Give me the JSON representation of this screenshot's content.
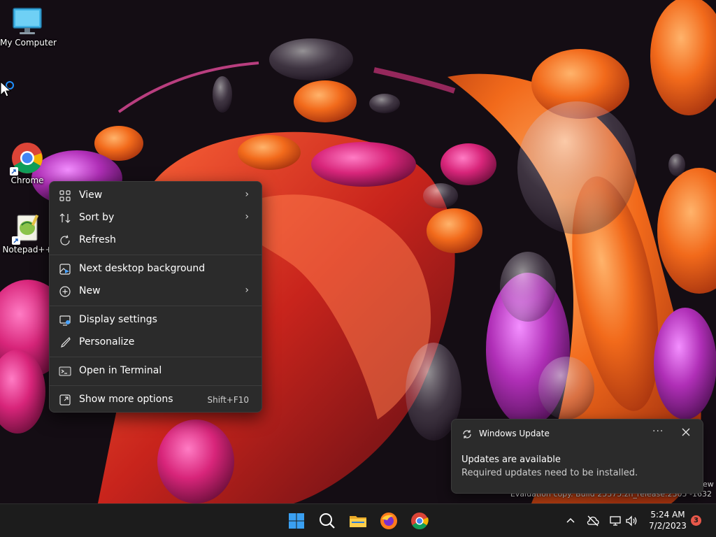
{
  "desktop": {
    "icons": [
      {
        "label": "My Computer",
        "icon": "monitor-icon"
      },
      {
        "label": "Chrome",
        "icon": "chrome-icon"
      },
      {
        "label": "Notepad++",
        "icon": "notepadpp-icon"
      }
    ]
  },
  "context_menu": {
    "items": [
      {
        "label": "View",
        "icon": "grid-icon",
        "has_submenu": true
      },
      {
        "label": "Sort by",
        "icon": "sort-icon",
        "has_submenu": true
      },
      {
        "label": "Refresh",
        "icon": "refresh-icon"
      },
      {
        "label": "Next desktop background",
        "icon": "next-background-icon"
      },
      {
        "label": "New",
        "icon": "plus-circle-icon",
        "has_submenu": true
      },
      {
        "label": "Display settings",
        "icon": "display-icon"
      },
      {
        "label": "Personalize",
        "icon": "brush-icon"
      },
      {
        "label": "Open in Terminal",
        "icon": "terminal-icon"
      },
      {
        "label": "Show more options",
        "icon": "more-options-icon",
        "shortcut": "Shift+F10"
      }
    ]
  },
  "notification": {
    "app_name": "Windows Update",
    "more_glyph": "···",
    "title": "Updates are available",
    "body": "Required updates need to be installed."
  },
  "watermark": {
    "line_fragment": "ew",
    "line": "Evaluation copy. Build 25375.zn_release.2305 -1632"
  },
  "taskbar": {
    "apps": [
      "windows-start-icon",
      "search-icon",
      "file-explorer-icon",
      "firefox-icon",
      "chrome-icon"
    ],
    "tray": [
      "chevron-up-icon",
      "cloud-off-icon",
      "network-icon",
      "volume-icon"
    ],
    "time": "5:24 AM",
    "date": "7/2/2023",
    "notification_count": "3"
  },
  "colors": {
    "menu_bg": "#2b2b2b",
    "taskbar_bg": "#1c1c1c",
    "badge": "#e8584a",
    "wallpaper_bg": "#140d14",
    "accent_orange": "#f26a1b",
    "accent_pink": "#d8257a"
  }
}
